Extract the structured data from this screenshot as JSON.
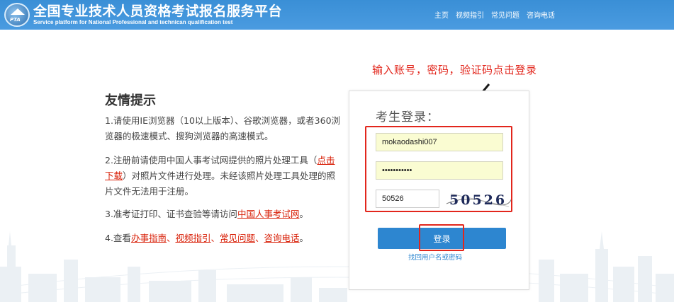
{
  "header": {
    "title": "全国专业技术人员资格考试报名服务平台",
    "subtitle": "Service platform for National Professional and technican qualification test",
    "logo_text": "PTA",
    "nav": [
      "主页",
      "视频指引",
      "常见问题",
      "咨询电话"
    ]
  },
  "annotation": {
    "text": "输入账号，密码，验证码点击登录",
    "color": "#e2261c"
  },
  "tips": {
    "title": "友情提示",
    "tip1": "1.请使用IE浏览器（10以上版本）、谷歌浏览器，或者360浏览器的极速模式、搜狗浏览器的高速模式。",
    "tip2_before": "2.注册前请使用中国人事考试网提供的照片处理工具（",
    "tip2_link": "点击下载",
    "tip2_after": "）对照片文件进行处理。未经该照片处理工具处理的照片文件无法用于注册。",
    "tip3_before": "3.准考证打印、证书查验等请访问",
    "tip3_link": "中国人事考试网",
    "tip3_after": "。",
    "tip4_before": "4.查看",
    "tip4_links": [
      "办事指南",
      "视频指引",
      "常见问题",
      "咨询电话"
    ],
    "tip4_sep": "、",
    "tip4_after": "。"
  },
  "login": {
    "title": "考生登录：",
    "username": "mokaodashi007",
    "password": "•••••••••••",
    "captcha_input": "50526",
    "captcha_image_text": "50526",
    "submit_label": "登录",
    "forgot_label": "找回用户名或密码",
    "button_color": "#2d86d0",
    "field_bg": "#fafcd2"
  }
}
